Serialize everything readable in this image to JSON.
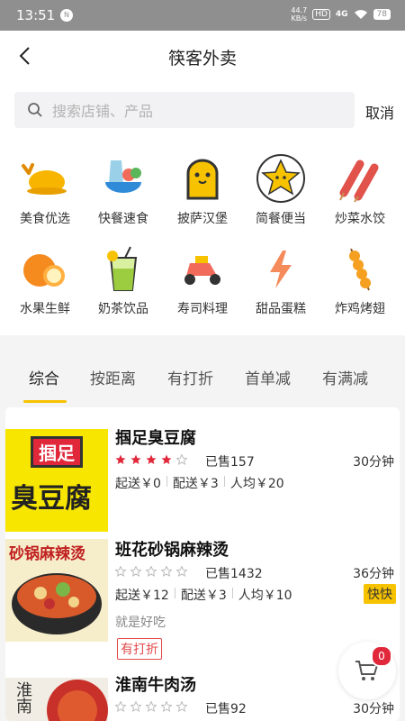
{
  "status": {
    "time": "13:51",
    "badge": "N",
    "net_speed": "44.7",
    "net_unit": "KB/s",
    "hd": "HD",
    "signal": "4G",
    "battery": "78"
  },
  "navbar": {
    "title": "筷客外卖",
    "back_icon": "chevron-left-icon"
  },
  "search": {
    "placeholder": "搜索店铺、产品",
    "value": "",
    "cancel_label": "取消"
  },
  "categories": [
    {
      "label": "美食优选",
      "icon": "roast-chicken-icon"
    },
    {
      "label": "快餐速食",
      "icon": "fast-food-bowl-icon"
    },
    {
      "label": "披萨汉堡",
      "icon": "toast-bread-icon"
    },
    {
      "label": "简餐便当",
      "icon": "star-face-icon"
    },
    {
      "label": "炒菜水饺",
      "icon": "sausage-skewer-icon"
    },
    {
      "label": "水果生鲜",
      "icon": "orange-icon"
    },
    {
      "label": "奶茶饮品",
      "icon": "juice-cup-icon"
    },
    {
      "label": "寿司料理",
      "icon": "scooter-icon"
    },
    {
      "label": "甜品蛋糕",
      "icon": "lightning-icon"
    },
    {
      "label": "炸鸡烤翅",
      "icon": "fried-skewer-icon"
    }
  ],
  "tabs": [
    {
      "label": "综合",
      "active": true
    },
    {
      "label": "按距离",
      "active": false
    },
    {
      "label": "有打折",
      "active": false
    },
    {
      "label": "首单减",
      "active": false
    },
    {
      "label": "有满减",
      "active": false
    }
  ],
  "shops": [
    {
      "name": "掴足臭豆腐",
      "thumb_text": "掴足",
      "thumb_text2": "臭豆腐",
      "rating": 4,
      "sold": "已售157",
      "time": "30分钟",
      "fees": [
        "起送￥0",
        "配送￥3",
        "人均￥20"
      ]
    },
    {
      "name": "班花砂锅麻辣烫",
      "thumb_text": "砂锅麻辣烫",
      "rating": 0,
      "sold": "已售1432",
      "time": "36分钟",
      "fees": [
        "起送￥12",
        "配送￥3",
        "人均￥10"
      ],
      "fast_label": "快快",
      "note": "就是好吃",
      "discount_label": "有打折"
    },
    {
      "name": "淮南牛肉汤",
      "thumb_text": "淮南",
      "rating": 0,
      "sold": "已售92",
      "time": "30分钟"
    }
  ],
  "cart": {
    "count": "0"
  },
  "colors": {
    "accent": "#f7c300",
    "star": "#e0283a",
    "discount": "#e24a4a"
  }
}
